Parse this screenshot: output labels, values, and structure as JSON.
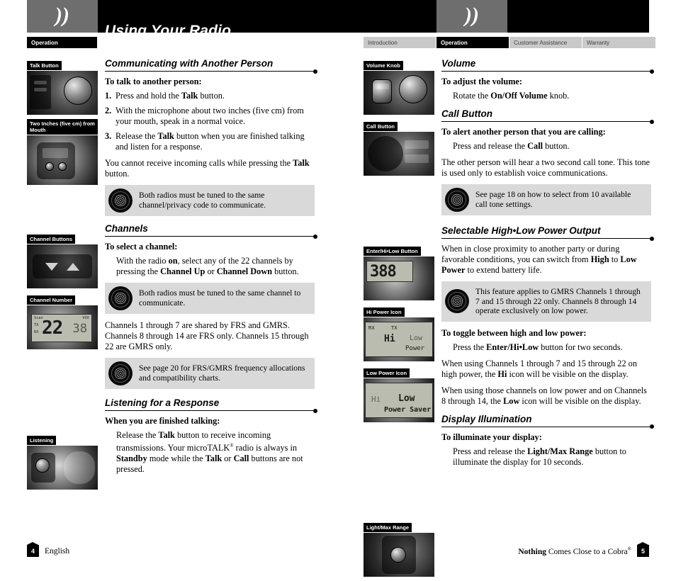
{
  "header": {
    "chapter_title": "Using Your Radio",
    "logo_glyph": "))",
    "tabs_right": [
      {
        "label": "Introduction",
        "active": false
      },
      {
        "label": "Operation",
        "active": true
      },
      {
        "label": "Customer Assistance",
        "active": false
      },
      {
        "label": "Warranty",
        "active": false
      }
    ],
    "tab_left": {
      "label": "Operation",
      "active": true
    }
  },
  "left_page": {
    "figures": [
      {
        "label": "Talk Button"
      },
      {
        "label": "Two Inches  (five cm) from Mouth"
      },
      {
        "label": "Channel Buttons"
      },
      {
        "label": "Channel Number",
        "lcd_big": "22",
        "lcd_big2": "38",
        "lcd_tl": "Scan",
        "lcd_tr": "VOX",
        "lcd_l1": "TX",
        "lcd_l2": "RX"
      },
      {
        "label": "Listening"
      }
    ],
    "sections": [
      {
        "heading": "Communicating with Another Person",
        "lead": "To talk to another person:",
        "steps": [
          {
            "num": "1.",
            "text": "Press and hold the <b>Talk</b> button."
          },
          {
            "num": "2.",
            "text": "With the microphone about two inches (five cm) from your mouth, speak in a normal voice."
          },
          {
            "num": "3.",
            "text": "Release the <b>Talk</b> button when you are finished talking and listen for a response."
          }
        ],
        "after": "You cannot receive incoming calls while pressing the <b>Talk</b> button.",
        "note": "Both radios must be tuned to the same channel/privacy code to communicate."
      },
      {
        "heading": "Channels",
        "lead": "To select a channel:",
        "body_indent": "With the radio <b>on</b>, select any of the 22 channels by pressing the <b>Channel Up</b> or <b>Channel Down</b> button.",
        "note1": "Both radios must be tuned to the same channel to communicate.",
        "after": "Channels 1 through 7 are shared by FRS and GMRS. Channels 8 through 14 are FRS only. Channels 15 through 22 are GMRS only.",
        "note2": "See page 20 for FRS/GMRS frequency allocations and compatibility charts."
      },
      {
        "heading": "Listening for a Response",
        "lead": "When you are finished talking:",
        "body_indent": "Release the <b>Talk</b> button to receive incoming transmissions. Your microTALK<sup>®</sup> radio is always in <b>Standby</b> mode while the <b>Talk</b> or <b>Call</b> buttons are not pressed."
      }
    ],
    "footer": {
      "page": "4",
      "text": "English"
    }
  },
  "right_page": {
    "figures": [
      {
        "label": "Volume Knob"
      },
      {
        "label": "Call Button"
      },
      {
        "label": "Enter/Hi•Low Button",
        "lcd_big": "388"
      },
      {
        "label": "Hi Power Icon"
      },
      {
        "label": "Low Power Icon"
      },
      {
        "label": "Light/Max Range"
      }
    ],
    "sections": [
      {
        "heading": "Volume",
        "lead": "To adjust the volume:",
        "body_indent": "Rotate the <b>On/Off Volume</b> knob."
      },
      {
        "heading": "Call Button",
        "lead": "To alert another person that you are calling:",
        "body_indent": "Press and release the <b>Call</b> button.",
        "after": "The other person will hear a two second call tone. This tone is used only to establish voice communications.",
        "note": "See page 18 on how to select from 10 available call tone settings."
      },
      {
        "heading": "Selectable High•Low Power Output",
        "body": "When in close proximity to another party or during favorable conditions, you can switch from <b>High</b> to <b>Low Power</b> to extend battery life.",
        "note": "This feature applies to GMRS Channels 1 through 7 and 15 through 22 only. Channels 8 through 14 operate exclusively on low power.",
        "lead": "To toggle between high and low power:",
        "body_indent": "Press the <b>Enter/Hi•Low</b> button for two seconds.",
        "after1": "When using Channels 1 through 7 and 15 through 22 on high power, the <b>Hi</b> icon will be visible on the display.",
        "after2": "When using those channels on low power and on Channels 8 through 14, the <b>Low</b> icon will be visible on the display."
      },
      {
        "heading": "Display Illumination",
        "lead": "To illuminate your display:",
        "body_indent": "Press and release the <b>Light/Max Range</b> button to illuminate the display for 10 seconds."
      }
    ],
    "footer": {
      "page": "5",
      "text_bold": "Nothing",
      "text": " Comes Close to a Cobra",
      "sup": "®"
    }
  },
  "lcd_icons": {
    "hi": "Hi",
    "low": "Low",
    "power": "Power",
    "power_saver": "Power Saver",
    "rx": "RX",
    "tx": "TX"
  }
}
